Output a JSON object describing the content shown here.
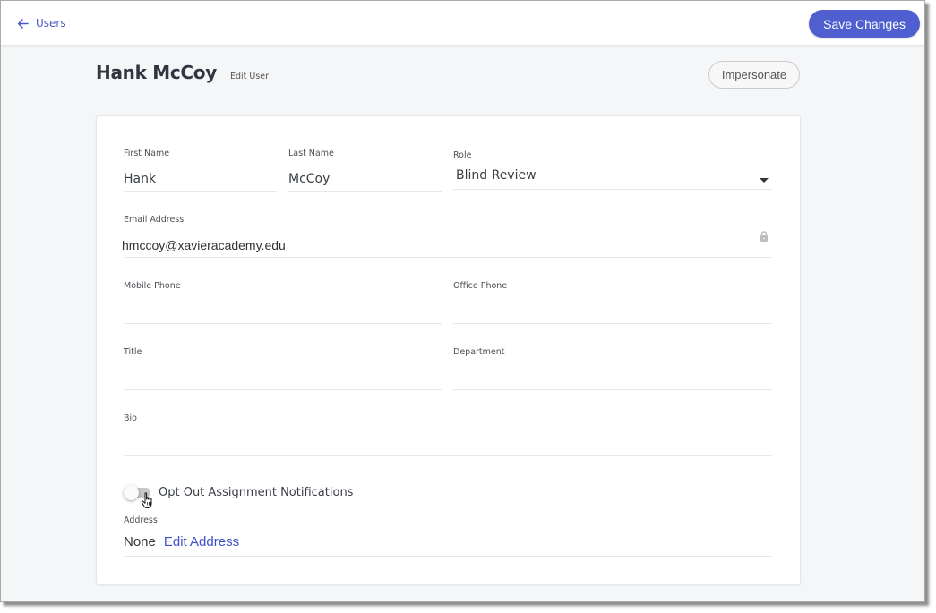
{
  "topbar": {
    "back_label": "Users",
    "back_icon": "arrow-left-icon",
    "save_label": "Save Changes"
  },
  "header": {
    "title": "Hank McCoy",
    "subtitle": "Edit User",
    "impersonate_label": "Impersonate"
  },
  "form": {
    "first_name": {
      "label": "First Name",
      "value": "Hank"
    },
    "last_name": {
      "label": "Last Name",
      "value": "McCoy"
    },
    "role": {
      "label": "Role",
      "value": "Blind Review",
      "icon": "caret-down-icon"
    },
    "email": {
      "label": "Email Address",
      "value": "hmccoy@xavieracademy.edu",
      "icon": "lock-icon"
    },
    "mobile_phone": {
      "label": "Mobile Phone",
      "value": ""
    },
    "office_phone": {
      "label": "Office Phone",
      "value": ""
    },
    "title": {
      "label": "Title",
      "value": ""
    },
    "department": {
      "label": "Department",
      "value": ""
    },
    "bio": {
      "label": "Bio",
      "value": ""
    },
    "opt_out": {
      "label": "Opt Out Assignment Notifications",
      "checked": false
    },
    "address": {
      "label": "Address",
      "value": "None",
      "edit_label": "Edit Address"
    }
  },
  "colors": {
    "accent": "#4f5fd0",
    "link": "#3b52c9",
    "page_bg": "#f5f6f8"
  }
}
